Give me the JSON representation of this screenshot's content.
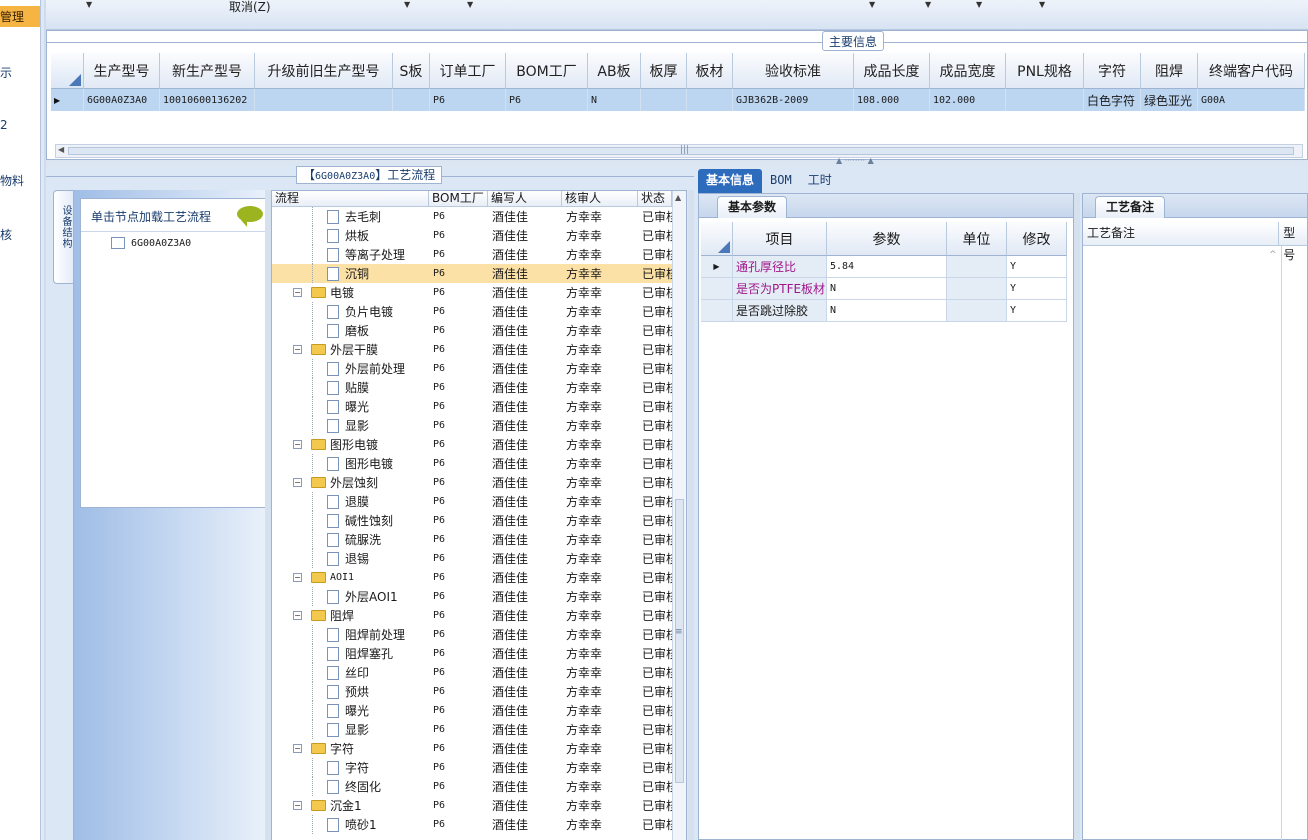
{
  "left_nav": {
    "items": [
      "管理",
      "示",
      "2",
      "物料",
      "核"
    ]
  },
  "toolbar": {
    "cancel_label": "取消(Z)"
  },
  "main_info": {
    "title": "主要信息",
    "columns": [
      "生产型号",
      "新生产型号",
      "升级前旧生产型号",
      "S板",
      "订单工厂",
      "BOM工厂",
      "AB板",
      "板厚",
      "板材",
      "验收标准",
      "成品长度",
      "成品宽度",
      "PNL规格",
      "字符",
      "阻焊",
      "终端客户代码"
    ],
    "row": [
      "6G00A0Z3A0",
      "10010600136202",
      "",
      "",
      "P6",
      "P6",
      "N",
      "",
      "",
      "GJB362B-2009",
      "108.000",
      "102.000",
      "",
      "白色字符",
      "绿色亚光",
      "G00A"
    ]
  },
  "process": {
    "title_prefix": "【",
    "title_code": "6G00A0Z3A0",
    "title_suffix": "】工艺流程",
    "vertical_tab": "设备结构",
    "hint": "单击节点加载工艺流程",
    "root_node": "6G00A0Z3A0",
    "columns": [
      "流程",
      "BOM工厂",
      "编写人",
      "核审人",
      "状态"
    ],
    "rows": [
      {
        "kind": "leaf",
        "name": "去毛刺",
        "factory": "P6",
        "writer": "酒佳佳",
        "reviewer": "方幸幸",
        "status": "已审核"
      },
      {
        "kind": "leaf",
        "name": "烘板",
        "factory": "P6",
        "writer": "酒佳佳",
        "reviewer": "方幸幸",
        "status": "已审核"
      },
      {
        "kind": "leaf",
        "name": "等离子处理",
        "factory": "P6",
        "writer": "酒佳佳",
        "reviewer": "方幸幸",
        "status": "已审核"
      },
      {
        "kind": "leaf",
        "name": "沉铜",
        "factory": "P6",
        "writer": "酒佳佳",
        "reviewer": "方幸幸",
        "status": "已审核",
        "selected": true
      },
      {
        "kind": "group",
        "name": "电镀",
        "factory": "P6",
        "writer": "酒佳佳",
        "reviewer": "方幸幸",
        "status": "已审核"
      },
      {
        "kind": "leaf",
        "name": "负片电镀",
        "factory": "P6",
        "writer": "酒佳佳",
        "reviewer": "方幸幸",
        "status": "已审核"
      },
      {
        "kind": "leaf",
        "name": "磨板",
        "factory": "P6",
        "writer": "酒佳佳",
        "reviewer": "方幸幸",
        "status": "已审核"
      },
      {
        "kind": "group",
        "name": "外层干膜",
        "factory": "P6",
        "writer": "酒佳佳",
        "reviewer": "方幸幸",
        "status": "已审核"
      },
      {
        "kind": "leaf",
        "name": "外层前处理",
        "factory": "P6",
        "writer": "酒佳佳",
        "reviewer": "方幸幸",
        "status": "已审核"
      },
      {
        "kind": "leaf",
        "name": "贴膜",
        "factory": "P6",
        "writer": "酒佳佳",
        "reviewer": "方幸幸",
        "status": "已审核"
      },
      {
        "kind": "leaf",
        "name": "曝光",
        "factory": "P6",
        "writer": "酒佳佳",
        "reviewer": "方幸幸",
        "status": "已审核"
      },
      {
        "kind": "leaf",
        "name": "显影",
        "factory": "P6",
        "writer": "酒佳佳",
        "reviewer": "方幸幸",
        "status": "已审核"
      },
      {
        "kind": "group",
        "name": "图形电镀",
        "factory": "P6",
        "writer": "酒佳佳",
        "reviewer": "方幸幸",
        "status": "已审核"
      },
      {
        "kind": "leaf",
        "name": "图形电镀",
        "factory": "P6",
        "writer": "酒佳佳",
        "reviewer": "方幸幸",
        "status": "已审核"
      },
      {
        "kind": "group",
        "name": "外层蚀刻",
        "factory": "P6",
        "writer": "酒佳佳",
        "reviewer": "方幸幸",
        "status": "已审核"
      },
      {
        "kind": "leaf",
        "name": "退膜",
        "factory": "P6",
        "writer": "酒佳佳",
        "reviewer": "方幸幸",
        "status": "已审核"
      },
      {
        "kind": "leaf",
        "name": "碱性蚀刻",
        "factory": "P6",
        "writer": "酒佳佳",
        "reviewer": "方幸幸",
        "status": "已审核"
      },
      {
        "kind": "leaf",
        "name": "硫脲洗",
        "factory": "P6",
        "writer": "酒佳佳",
        "reviewer": "方幸幸",
        "status": "已审核"
      },
      {
        "kind": "leaf",
        "name": "退锡",
        "factory": "P6",
        "writer": "酒佳佳",
        "reviewer": "方幸幸",
        "status": "已审核"
      },
      {
        "kind": "group",
        "name": "AOI1",
        "factory": "P6",
        "writer": "酒佳佳",
        "reviewer": "方幸幸",
        "status": "已审核"
      },
      {
        "kind": "leaf",
        "name": "外层AOI1",
        "factory": "P6",
        "writer": "酒佳佳",
        "reviewer": "方幸幸",
        "status": "已审核"
      },
      {
        "kind": "group",
        "name": "阻焊",
        "factory": "P6",
        "writer": "酒佳佳",
        "reviewer": "方幸幸",
        "status": "已审核"
      },
      {
        "kind": "leaf",
        "name": "阻焊前处理",
        "factory": "P6",
        "writer": "酒佳佳",
        "reviewer": "方幸幸",
        "status": "已审核"
      },
      {
        "kind": "leaf",
        "name": "阻焊塞孔",
        "factory": "P6",
        "writer": "酒佳佳",
        "reviewer": "方幸幸",
        "status": "已审核"
      },
      {
        "kind": "leaf",
        "name": "丝印",
        "factory": "P6",
        "writer": "酒佳佳",
        "reviewer": "方幸幸",
        "status": "已审核"
      },
      {
        "kind": "leaf",
        "name": "预烘",
        "factory": "P6",
        "writer": "酒佳佳",
        "reviewer": "方幸幸",
        "status": "已审核"
      },
      {
        "kind": "leaf",
        "name": "曝光",
        "factory": "P6",
        "writer": "酒佳佳",
        "reviewer": "方幸幸",
        "status": "已审核"
      },
      {
        "kind": "leaf",
        "name": "显影",
        "factory": "P6",
        "writer": "酒佳佳",
        "reviewer": "方幸幸",
        "status": "已审核"
      },
      {
        "kind": "group",
        "name": "字符",
        "factory": "P6",
        "writer": "酒佳佳",
        "reviewer": "方幸幸",
        "status": "已审核"
      },
      {
        "kind": "leaf",
        "name": "字符",
        "factory": "P6",
        "writer": "酒佳佳",
        "reviewer": "方幸幸",
        "status": "已审核"
      },
      {
        "kind": "leaf",
        "name": "终固化",
        "factory": "P6",
        "writer": "酒佳佳",
        "reviewer": "方幸幸",
        "status": "已审核"
      },
      {
        "kind": "group",
        "name": "沉金1",
        "factory": "P6",
        "writer": "酒佳佳",
        "reviewer": "方幸幸",
        "status": "已审核"
      },
      {
        "kind": "leaf",
        "name": "喷砂1",
        "factory": "P6",
        "writer": "酒佳佳",
        "reviewer": "方幸幸",
        "status": "已审核"
      }
    ]
  },
  "right": {
    "tabs": [
      "基本信息",
      "BOM",
      "工时"
    ],
    "sub_tab": "基本参数",
    "param_columns": [
      "项目",
      "参数",
      "单位",
      "修改"
    ],
    "params": [
      {
        "item": "通孔厚径比",
        "value": "5.84",
        "unit": "",
        "edit": "Y",
        "highlight": true
      },
      {
        "item": "是否为PTFE板材",
        "value": "N",
        "unit": "",
        "edit": "Y",
        "highlight": true
      },
      {
        "item": "是否跳过除胶",
        "value": "N",
        "unit": "",
        "edit": "Y",
        "highlight": false
      }
    ],
    "remark_tab": "工艺备注",
    "remark_columns": [
      "工艺备注",
      "型号"
    ]
  }
}
